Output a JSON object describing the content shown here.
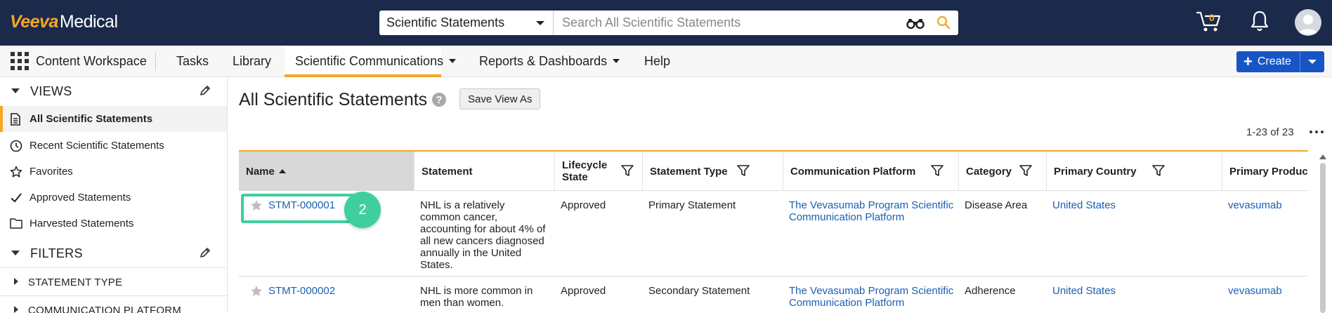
{
  "brand": {
    "name_accent": "Veeva",
    "name_rest": "Medical",
    "accent_color": "#f5a623",
    "header_bg": "#1b2a4a"
  },
  "search": {
    "scope": "Scientific Statements",
    "placeholder": "Search All Scientific Statements"
  },
  "header_icons": {
    "cart_count": "0",
    "cart": "cart-icon",
    "notifications": "bell-icon",
    "user": "avatar-icon"
  },
  "nav": {
    "workspace": "Content Workspace",
    "items": [
      {
        "label": "Tasks",
        "dropdown": false
      },
      {
        "label": "Library",
        "dropdown": false
      },
      {
        "label": "Scientific Communications",
        "dropdown": true,
        "active": true
      },
      {
        "label": "Reports & Dashboards",
        "dropdown": true
      },
      {
        "label": "Help",
        "dropdown": false
      }
    ],
    "create_label": "Create"
  },
  "sidebar": {
    "views_heading": "VIEWS",
    "views": [
      {
        "label": "All Scientific Statements",
        "icon": "document-icon",
        "active": true
      },
      {
        "label": "Recent Scientific Statements",
        "icon": "clock-icon"
      },
      {
        "label": "Favorites",
        "icon": "star-icon"
      },
      {
        "label": "Approved Statements",
        "icon": "check-icon"
      },
      {
        "label": "Harvested Statements",
        "icon": "folder-icon"
      }
    ],
    "filters_heading": "FILTERS",
    "filters": [
      {
        "label": "STATEMENT TYPE"
      },
      {
        "label": "COMMUNICATION PLATFORM"
      }
    ]
  },
  "page": {
    "title": "All Scientific Statements",
    "save_view_label": "Save View As",
    "count": "1-23 of 23"
  },
  "table": {
    "columns": [
      "Name",
      "Statement",
      "Lifecycle State",
      "Statement Type",
      "Communication Platform",
      "Category",
      "Primary Country",
      "Primary Product N"
    ],
    "rows": [
      {
        "name": "STMT-000001",
        "statement": "NHL is a relatively common cancer, accounting for about 4% of all new cancers diagnosed annually in the United States.",
        "lifecycle": "Approved",
        "type": "Primary Statement",
        "platform": "The Vevasumab Program Scientific Communication Platform",
        "category": "Disease Area",
        "country": "United States",
        "product": "vevasumab"
      },
      {
        "name": "STMT-000002",
        "statement": "NHL is more common in men than women.",
        "lifecycle": "Approved",
        "type": "Secondary Statement",
        "platform": "The Vevasumab Program Scientific Communication Platform",
        "category": "Adherence",
        "country": "United States",
        "product": "vevasumab"
      }
    ]
  },
  "annotation": {
    "step_number": "2",
    "color": "#3fcf9e"
  }
}
